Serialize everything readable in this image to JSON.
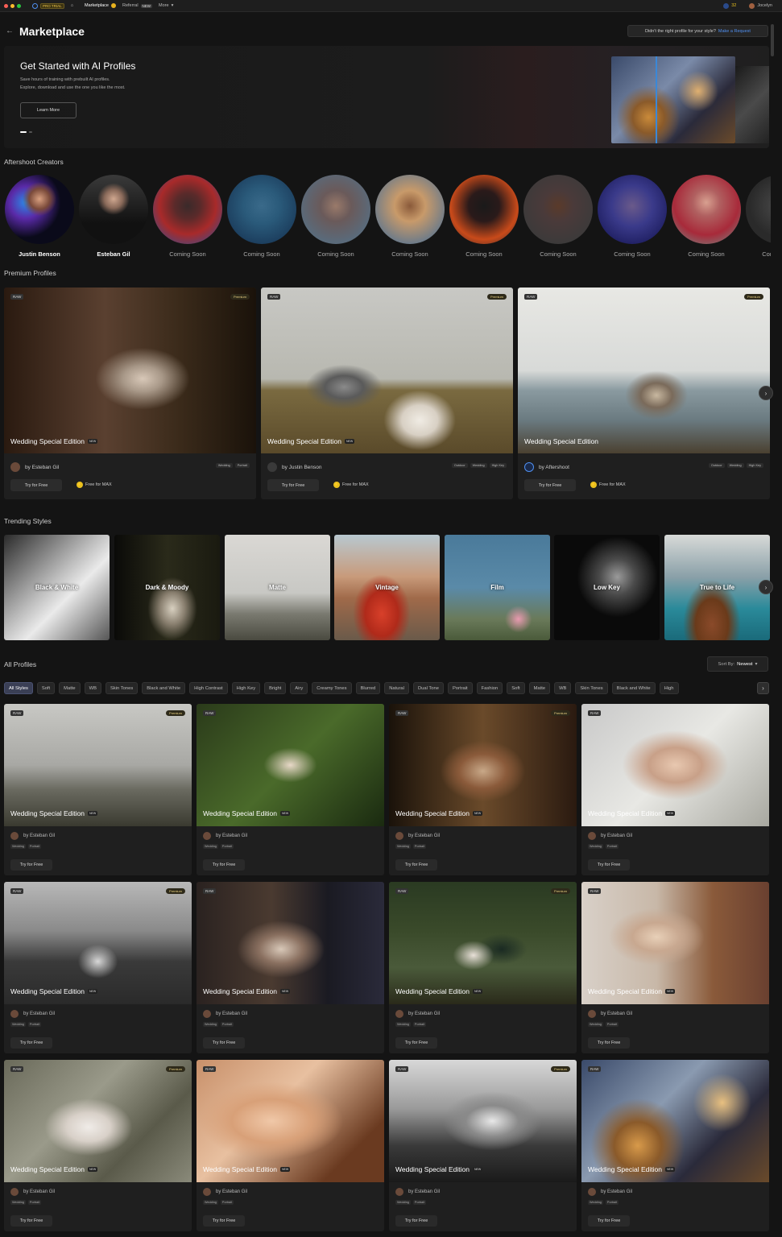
{
  "topbar": {
    "pro_trial": "PRO TRIAL",
    "marketplace": "Marketplace",
    "referral": "Referral",
    "referral_badge": "NEW",
    "more": "More",
    "credits": "32",
    "user": "Jocelyn"
  },
  "header": {
    "title": "Marketplace",
    "request_text": "Didn't the right profile for your style?",
    "request_link": "Make a Request"
  },
  "hero": {
    "title": "Get Started with AI Profiles",
    "line1": "Save hours of training with prebuilt AI profiles.",
    "line2": "Explore, download and use the one you like the most.",
    "button": "Learn More"
  },
  "sections": {
    "creators": "Aftershoot Creators",
    "premium": "Premium Profiles",
    "trending": "Trending Styles",
    "all": "All Profiles"
  },
  "creators": [
    {
      "name": "Justin Benson",
      "bold": true
    },
    {
      "name": "Esteban Gil",
      "bold": true
    },
    {
      "name": "Coming Soon"
    },
    {
      "name": "Coming Soon"
    },
    {
      "name": "Coming Soon"
    },
    {
      "name": "Coming Soon"
    },
    {
      "name": "Coming Soon"
    },
    {
      "name": "Coming Soon"
    },
    {
      "name": "Coming Soon"
    },
    {
      "name": "Coming Soon"
    },
    {
      "name": "Coming Soon"
    }
  ],
  "premium_cards": [
    {
      "raw": "RAW",
      "premium": "Premium",
      "title": "Wedding Special Edition",
      "new": "NEW",
      "author": "by Esteban Gil",
      "tags": [
        "Wedding",
        "Portrait"
      ],
      "try": "Try for Free",
      "free": "Free for MAX"
    },
    {
      "raw": "RAW",
      "premium": "Premium",
      "title": "Wedding Special Edition",
      "new": "NEW",
      "author": "by Justin Benson",
      "tags": [
        "Outdoor",
        "Wedding",
        "High Key"
      ],
      "try": "Try for Free",
      "free": "Free for MAX"
    },
    {
      "raw": "RAW",
      "premium": "Premium",
      "title": "Wedding Special Edition",
      "new": "",
      "author": "by Aftershoot",
      "tags": [
        "Outdoor",
        "Wedding",
        "High Key"
      ],
      "try": "Try for Free",
      "free": "Free for MAX"
    }
  ],
  "trending": [
    "Black & White",
    "Dark & Moody",
    "Matte",
    "Vintage",
    "Film",
    "Low Key",
    "True to Life"
  ],
  "filters": [
    "All Styles",
    "Soft",
    "Matte",
    "WB",
    "Skin Tones",
    "Black and White",
    "High Contrast",
    "High Key",
    "Bright",
    "Airy",
    "Creamy Tones",
    "Blurred",
    "Natural",
    "Dual Tone",
    "Portrait",
    "Fashion",
    "Soft",
    "Matte",
    "WB",
    "Skin Tones",
    "Black and White",
    "High"
  ],
  "sort": {
    "label": "Sort By:",
    "value": "Newest"
  },
  "all_cards": [
    {
      "raw": "RAW",
      "premium": "Premium",
      "title": "Wedding Special Edition",
      "new": "NEW",
      "author": "by Esteban Gil",
      "tags": [
        "Wedding",
        "Portrait"
      ],
      "try": "Try for Free"
    },
    {
      "raw": "RAW",
      "premium": "",
      "title": "Wedding Special Edition",
      "new": "NEW",
      "author": "by Esteban Gil",
      "tags": [
        "Wedding",
        "Portrait"
      ],
      "try": "Try for Free"
    },
    {
      "raw": "RAW",
      "premium": "Premium",
      "title": "Wedding Special Edition",
      "new": "NEW",
      "author": "by Esteban Gil",
      "tags": [
        "Wedding",
        "Portrait"
      ],
      "try": "Try for Free"
    },
    {
      "raw": "RAW",
      "premium": "",
      "title": "Wedding Special Edition",
      "new": "NEW",
      "author": "by Esteban Gil",
      "tags": [
        "Wedding",
        "Portrait"
      ],
      "try": "Try for Free"
    },
    {
      "raw": "RAW",
      "premium": "Premium",
      "title": "Wedding Special Edition",
      "new": "NEW",
      "author": "by Esteban Gil",
      "tags": [
        "Wedding",
        "Portrait"
      ],
      "try": "Try for Free"
    },
    {
      "raw": "RAW",
      "premium": "",
      "title": "Wedding Special Edition",
      "new": "NEW",
      "author": "by Esteban Gil",
      "tags": [
        "Wedding",
        "Portrait"
      ],
      "try": "Try for Free"
    },
    {
      "raw": "RAW",
      "premium": "Premium",
      "title": "Wedding Special Edition",
      "new": "NEW",
      "author": "by Esteban Gil",
      "tags": [
        "Wedding",
        "Portrait"
      ],
      "try": "Try for Free"
    },
    {
      "raw": "RAW",
      "premium": "",
      "title": "Wedding Special Edition",
      "new": "NEW",
      "author": "by Esteban Gil",
      "tags": [
        "Wedding",
        "Portrait"
      ],
      "try": "Try for Free"
    },
    {
      "raw": "RAW",
      "premium": "Premium",
      "title": "Wedding Special Edition",
      "new": "NEW",
      "author": "by Esteban Gil",
      "tags": [
        "Wedding",
        "Portrait"
      ],
      "try": "Try for Free"
    },
    {
      "raw": "RAW",
      "premium": "",
      "title": "Wedding Special Edition",
      "new": "NEW",
      "author": "by Esteban Gil",
      "tags": [
        "Wedding",
        "Portrait"
      ],
      "try": "Try for Free"
    },
    {
      "raw": "RAW",
      "premium": "Premium",
      "title": "Wedding Special Edition",
      "new": "NEW",
      "author": "by Esteban Gil",
      "tags": [
        "Wedding",
        "Portrait"
      ],
      "try": "Try for Free"
    },
    {
      "raw": "RAW",
      "premium": "",
      "title": "Wedding Special Edition",
      "new": "NEW",
      "author": "by Esteban Gil",
      "tags": [
        "Wedding",
        "Portrait"
      ],
      "try": "Try for Free"
    }
  ],
  "icons": {
    "back": "arrow-left-icon",
    "home": "home-icon",
    "next": "chevron-right-icon",
    "bolt": "lightning-icon",
    "crown": "crown-icon"
  },
  "colors": {
    "accent": "#4f8ff0",
    "gold": "#e8c01e",
    "background": "#141414"
  }
}
